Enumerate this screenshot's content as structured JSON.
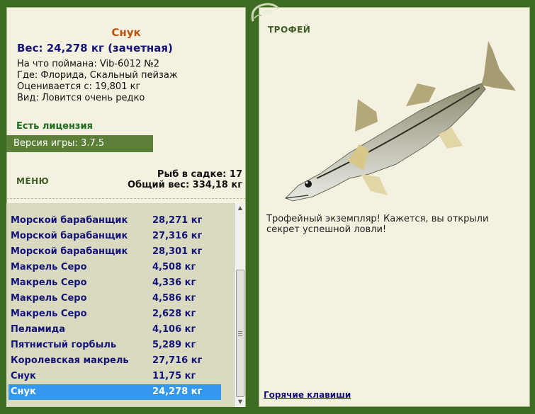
{
  "fish": {
    "name": "Снук",
    "weight_line": "Вес: 24,278 кг (зачетная)",
    "lure": "На что поймана: Vib-6012 №2",
    "location": "Где: Флорида, Скальный пейзаж",
    "valued_from": "Оценивается с: 19,801 кг",
    "rarity": "Вид: Ловится очень редко"
  },
  "license": "Есть лицензия",
  "version": "Версия игры: 3.7.5",
  "menu_label": "МЕНЮ",
  "stats": {
    "fish_count": "Рыб в садке: 17",
    "total_weight": "Общий вес: 334,18 кг"
  },
  "catch_list": [
    {
      "name": "Морской барабанщик",
      "weight": "28,271 кг"
    },
    {
      "name": "Морской барабанщик",
      "weight": "27,316 кг"
    },
    {
      "name": "Морской барабанщик",
      "weight": "28,301 кг"
    },
    {
      "name": "Макрель Серо",
      "weight": "4,508 кг"
    },
    {
      "name": "Макрель Серо",
      "weight": "4,336 кг"
    },
    {
      "name": "Макрель Серо",
      "weight": "4,586 кг"
    },
    {
      "name": "Макрель Серо",
      "weight": "2,628 кг"
    },
    {
      "name": "Пеламида",
      "weight": "4,106 кг"
    },
    {
      "name": "Пятнистый горбыль",
      "weight": "5,289 кг"
    },
    {
      "name": "Королевская макрель",
      "weight": "27,716 кг"
    },
    {
      "name": "Снук",
      "weight": "11,75 кг"
    },
    {
      "name": "Снук",
      "weight": "24,278 кг"
    }
  ],
  "selected_index": 11,
  "trophy": {
    "label": "ТРОФЕЙ",
    "text": "Трофейный экземпляр! Кажется, вы открыли секрет успешной ловли!"
  },
  "hotkeys_link": "Горячие клавиши",
  "colors": {
    "frame_green": "#3e6b22",
    "panel_bg": "#f4f1e0",
    "list_bg": "#d9dabf",
    "selection": "#3398ee",
    "title_orange": "#b8520e",
    "text_navy": "#14147a"
  }
}
